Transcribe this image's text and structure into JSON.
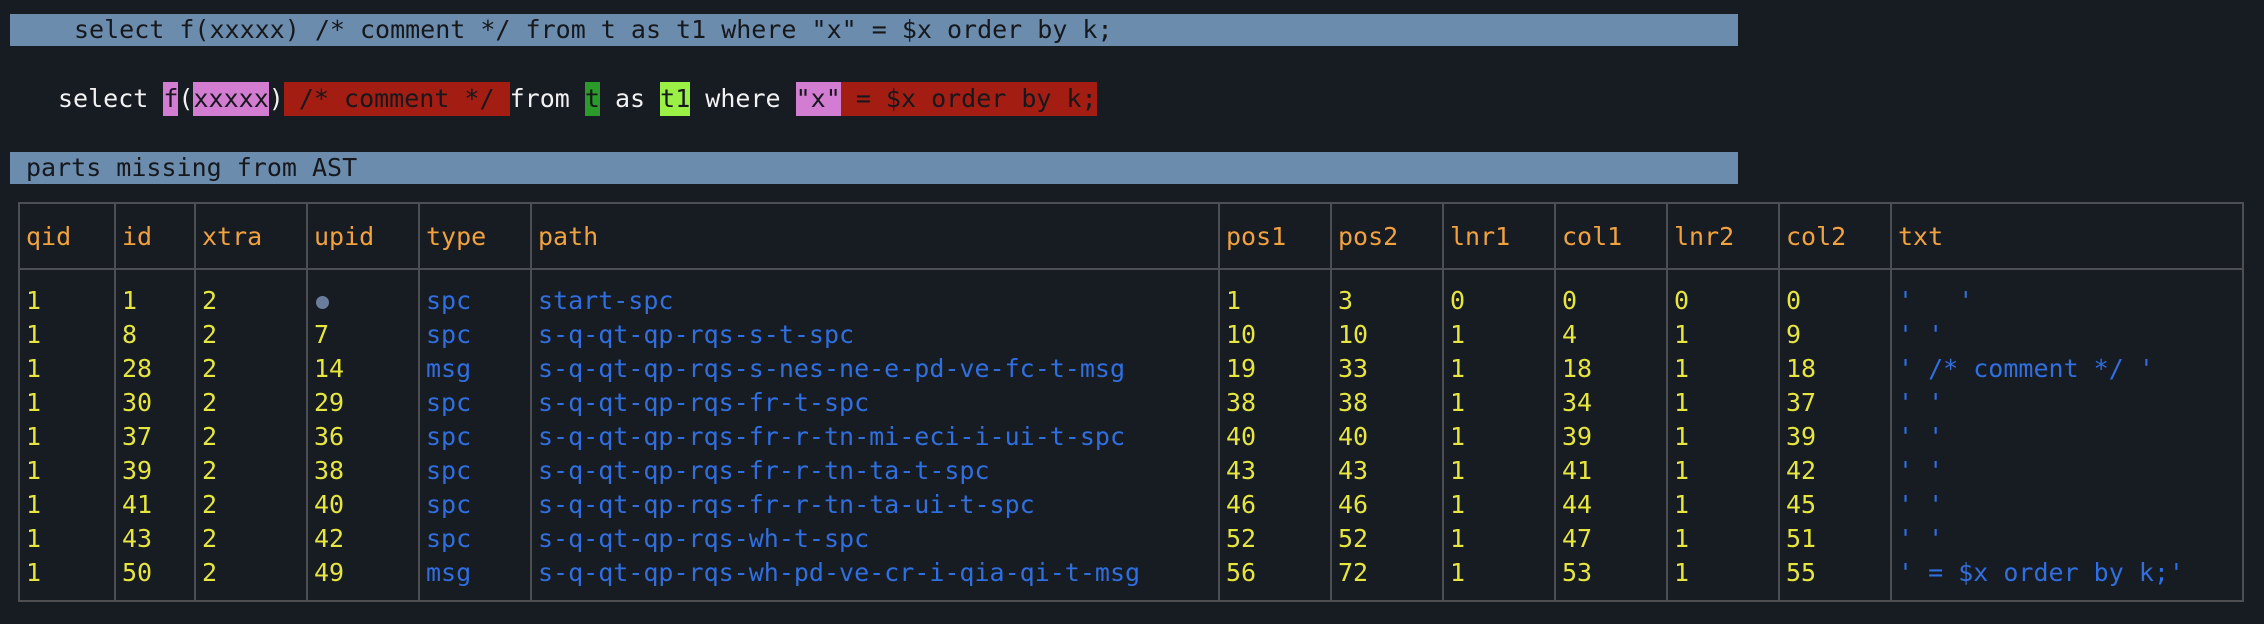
{
  "query_banner": "select f(xxxxx) /* comment */ from t as t1 where \"x\" = $x order by k;",
  "highlighted_query": [
    {
      "text": "select ",
      "style": "plain"
    },
    {
      "text": "f",
      "style": "pink"
    },
    {
      "text": "(",
      "style": "plain"
    },
    {
      "text": "xxxxx",
      "style": "pink"
    },
    {
      "text": ")",
      "style": "plain"
    },
    {
      "text": " /* comment */ ",
      "style": "red"
    },
    {
      "text": "from ",
      "style": "plain"
    },
    {
      "text": "t",
      "style": "green"
    },
    {
      "text": " as ",
      "style": "plain"
    },
    {
      "text": "t1",
      "style": "lime"
    },
    {
      "text": " where ",
      "style": "plain"
    },
    {
      "text": "\"x\"",
      "style": "pink"
    },
    {
      "text": " = $x order by k;",
      "style": "red"
    }
  ],
  "section_title": "parts missing from AST",
  "table": {
    "columns": [
      "qid",
      "id",
      "xtra",
      "upid",
      "type",
      "path",
      "pos1",
      "pos2",
      "lnr1",
      "col1",
      "lnr2",
      "col2",
      "txt"
    ],
    "rows": [
      [
        "1",
        "1",
        "2",
        "",
        "spc",
        "start-spc",
        "1",
        "3",
        "0",
        "0",
        "0",
        "0",
        "'   '"
      ],
      [
        "1",
        "8",
        "2",
        "7",
        "spc",
        "s-q-qt-qp-rqs-s-t-spc",
        "10",
        "10",
        "1",
        "4",
        "1",
        "9",
        "' '"
      ],
      [
        "1",
        "28",
        "2",
        "14",
        "msg",
        "s-q-qt-qp-rqs-s-nes-ne-e-pd-ve-fc-t-msg",
        "19",
        "33",
        "1",
        "18",
        "1",
        "18",
        "' /* comment */ '"
      ],
      [
        "1",
        "30",
        "2",
        "29",
        "spc",
        "s-q-qt-qp-rqs-fr-t-spc",
        "38",
        "38",
        "1",
        "34",
        "1",
        "37",
        "' '"
      ],
      [
        "1",
        "37",
        "2",
        "36",
        "spc",
        "s-q-qt-qp-rqs-fr-r-tn-mi-eci-i-ui-t-spc",
        "40",
        "40",
        "1",
        "39",
        "1",
        "39",
        "' '"
      ],
      [
        "1",
        "39",
        "2",
        "38",
        "spc",
        "s-q-qt-qp-rqs-fr-r-tn-ta-t-spc",
        "43",
        "43",
        "1",
        "41",
        "1",
        "42",
        "' '"
      ],
      [
        "1",
        "41",
        "2",
        "40",
        "spc",
        "s-q-qt-qp-rqs-fr-r-tn-ta-ui-t-spc",
        "46",
        "46",
        "1",
        "44",
        "1",
        "45",
        "' '"
      ],
      [
        "1",
        "43",
        "2",
        "42",
        "spc",
        "s-q-qt-qp-rqs-wh-t-spc",
        "52",
        "52",
        "1",
        "47",
        "1",
        "51",
        "' '"
      ],
      [
        "1",
        "50",
        "2",
        "49",
        "msg",
        "s-q-qt-qp-rqs-wh-pd-ve-cr-i-qia-qi-t-msg",
        "56",
        "72",
        "1",
        "53",
        "1",
        "55",
        "' = $x order by k;'"
      ]
    ]
  },
  "icons": {
    "null_value": "null-dot-icon"
  },
  "colors": {
    "background": "#171b22",
    "banner": "#6b8cad",
    "header_text": "#f2a23c",
    "number_text": "#e6e63c",
    "string_text": "#2f6fe0"
  }
}
